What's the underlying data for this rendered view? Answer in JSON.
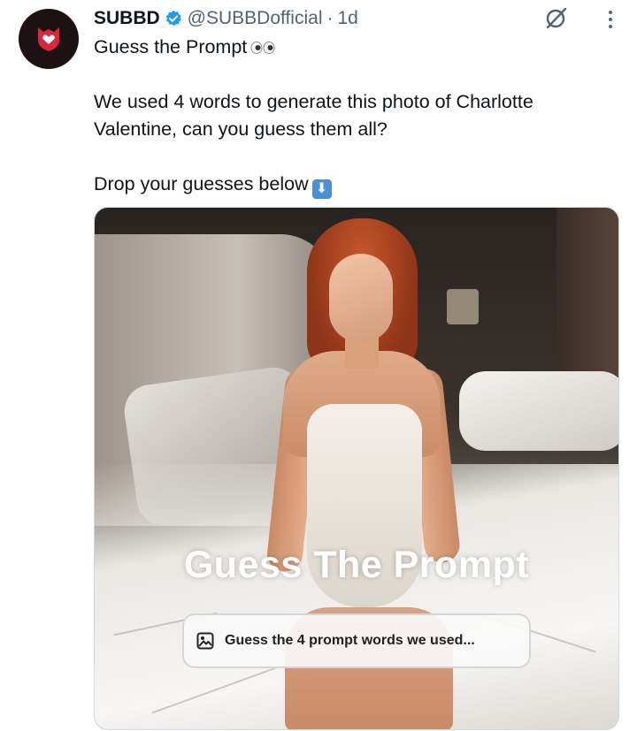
{
  "tweet": {
    "author_name": "SUBBD",
    "handle": "@SUBBDofficial",
    "separator": "·",
    "time": "1d",
    "line1": "Guess the Prompt",
    "line2": "We used 4 words to generate this photo of Charlotte Valentine, can you guess them all?",
    "line3": "Drop your guesses below"
  },
  "media": {
    "overlay_title": "Guess The Prompt",
    "prompt_placeholder": "Guess the 4 prompt words we used..."
  },
  "icons": {
    "avatar": "subbd-logo-icon",
    "verified": "verified-badge-icon",
    "grok": "grok-icon",
    "more": "more-dots-icon",
    "eyes": "eyes-emoji",
    "arrow": "down-arrow-emoji",
    "image": "image-icon"
  },
  "colors": {
    "verified": "#1d9bf0",
    "avatar_bg": "#1c1113",
    "logo_red": "#d9263a",
    "secondary_text": "#536471"
  }
}
